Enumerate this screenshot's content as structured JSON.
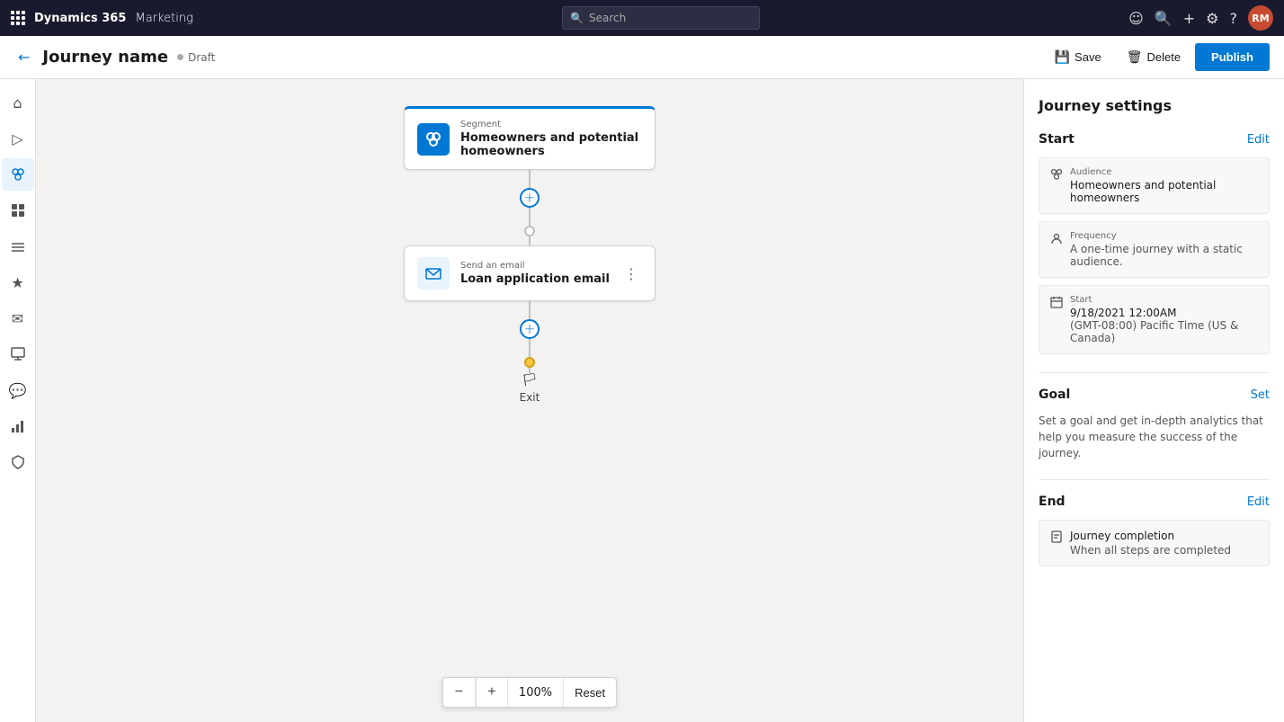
{
  "topbar": {
    "app_name": "Dynamics 365",
    "app_module": "Marketing",
    "search_placeholder": "Search",
    "icons": {
      "waffle": "⊞",
      "feedback": "☺",
      "help": "?",
      "plus": "+",
      "settings": "⚙"
    },
    "avatar_initials": "RM"
  },
  "secondbar": {
    "journey_name": "Journey name",
    "status": "Draft",
    "save_label": "Save",
    "delete_label": "Delete",
    "publish_label": "Publish"
  },
  "sidebar": {
    "items": [
      {
        "icon": "⌂",
        "name": "home",
        "active": false
      },
      {
        "icon": "▷",
        "name": "journeys",
        "active": false
      },
      {
        "icon": "⛓",
        "name": "segments",
        "active": true
      },
      {
        "icon": "✦",
        "name": "elements",
        "active": false
      },
      {
        "icon": "≋",
        "name": "triggers",
        "active": false
      },
      {
        "icon": "★",
        "name": "insights",
        "active": false
      },
      {
        "icon": "✉",
        "name": "messages",
        "active": false
      },
      {
        "icon": "▣",
        "name": "assets",
        "active": false
      },
      {
        "icon": "💬",
        "name": "conversations",
        "active": false
      },
      {
        "icon": "📊",
        "name": "analytics",
        "active": false
      },
      {
        "icon": "⚖",
        "name": "compliance",
        "active": false
      }
    ]
  },
  "canvas": {
    "nodes": [
      {
        "id": "segment-node",
        "type": "Segment",
        "label": "Homeowners and potential homeowners",
        "icon_type": "blue"
      },
      {
        "id": "email-node",
        "type": "Send an email",
        "label": "Loan application email",
        "icon_type": "light-blue"
      }
    ],
    "exit_label": "Exit",
    "zoom_level": "100%",
    "reset_label": "Reset"
  },
  "right_panel": {
    "title": "Journey settings",
    "start": {
      "section_title": "Start",
      "edit_label": "Edit",
      "audience": {
        "icon": "👥",
        "label": "Audience",
        "value": "Homeowners and potential homeowners"
      },
      "frequency": {
        "icon": "👤",
        "label": "Frequency",
        "value": "A one-time journey with a static audience."
      },
      "start_time": {
        "icon": "📅",
        "label": "Start",
        "date": "9/18/2021 12:00AM",
        "timezone": "(GMT-08:00) Pacific Time (US & Canada)"
      }
    },
    "goal": {
      "section_title": "Goal",
      "set_label": "Set",
      "description": "Set a goal and get in-depth analytics that help you measure the success of the journey."
    },
    "end": {
      "section_title": "End",
      "edit_label": "Edit",
      "completion": {
        "icon": "📄",
        "label": "Journey completion",
        "value": "When all steps are completed"
      }
    }
  }
}
